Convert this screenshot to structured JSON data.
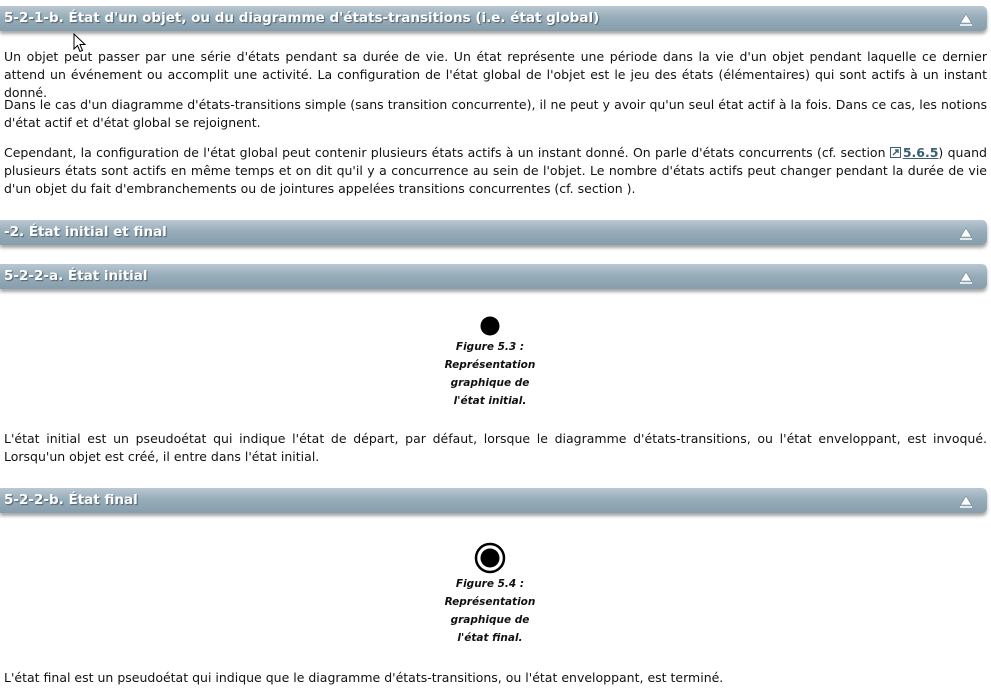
{
  "sections": [
    {
      "title": "5-2-1-b. État d'un objet, ou du diagramme d'états-transitions (i.e. état global)",
      "collapse_glyph": "▲"
    },
    {
      "title": "-2. État initial et final",
      "collapse_glyph": "▲"
    },
    {
      "title": "5-2-2-a. État initial",
      "collapse_glyph": "▲"
    },
    {
      "title": "5-2-2-b. État final",
      "collapse_glyph": "▲"
    }
  ],
  "etat_objet": {
    "p1": "Un objet peut passer par une série d'états pendant sa durée de vie. Un état représente une période dans la vie d'un objet pendant laquelle ce dernier attend un événement ou accomplit une activité. La configuration de l'état global de l'objet est le jeu des états (élémentaires) qui sont actifs à un instant donné.",
    "p2": "Dans le cas d'un diagramme d'états-transitions simple (sans transition concurrente), il ne peut y avoir qu'un seul état actif à la fois. Dans ce cas, les notions d'état actif et d'état global se rejoignent.",
    "p3_before": "Cependant, la configuration de l'état global peut contenir plusieurs états actifs à un instant donné. On parle d'états concurrents (cf. section ",
    "p3_link": "5.6.5",
    "p3_after": ") quand plusieurs états sont actifs en même temps et on dit qu'il y a concurrence au sein de l'objet. Le nombre d'états actifs peut changer pendant la durée de vie d'un objet du fait d'embranchements ou de jointures appelées transitions concurrentes (cf. section )."
  },
  "etat_initial": {
    "figure": {
      "caption_lines": [
        "Figure 5.3 :",
        "Représentation",
        "graphique de",
        "l'état initial."
      ]
    },
    "p1": "L'état initial est un pseudoétat qui indique l'état de départ, par défaut, lorsque le diagramme d'états-transitions, ou l'état enveloppant, est invoqué. Lorsqu'un objet est créé, il entre dans l'état initial."
  },
  "etat_final": {
    "figure": {
      "caption_lines": [
        "Figure 5.4 :",
        "Représentation",
        "graphique de",
        "l'état final."
      ]
    },
    "p1": "L'état final est un pseudoétat qui indique que le diagramme d'états-transitions, ou l'état enveloppant, est terminé."
  },
  "icons": {
    "collapse": "triangle-up-icon",
    "external_link": "external-link-icon",
    "cursor": "mouse-pointer-icon"
  },
  "colors": {
    "section_bar": "#98adba",
    "link": "#3b5e73"
  }
}
